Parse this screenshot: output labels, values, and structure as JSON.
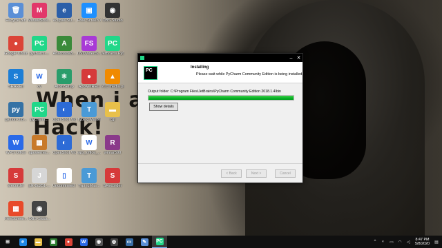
{
  "wallpaper": {
    "line1": "When i am",
    "line2": "Hack!"
  },
  "desktop_icons": [
    {
      "label": "Recycle Bin",
      "icon": "recycle-bin-icon",
      "color": "#5a8fd6",
      "glyph": "🗑"
    },
    {
      "label": "MovaviScre...",
      "icon": "movavi-icon",
      "color": "#e2386a",
      "glyph": "M"
    },
    {
      "label": "eclipse-SD...",
      "icon": "eclipse-shortcut-icon",
      "color": "#2c5fa8",
      "glyph": "e"
    },
    {
      "label": "Free Screen Video Re...",
      "icon": "free-screen-recorder-icon",
      "color": "#1e90ff",
      "glyph": "▣"
    },
    {
      "label": "OBS Studio",
      "icon": "obs-studio-icon",
      "color": "#333333",
      "glyph": "◉"
    },
    {
      "label": "Google Chrome",
      "icon": "chrome-icon",
      "color": "#db4437",
      "glyph": "●"
    },
    {
      "label": "pycharm-...",
      "icon": "pycharm-icon",
      "color": "#21d789",
      "glyph": "PC"
    },
    {
      "label": "Anaconda3...",
      "icon": "anaconda-icon",
      "color": "#3a8a3a",
      "glyph": "A"
    },
    {
      "label": "DVDVideoS... FreeStudio",
      "icon": "dvdvideosoft-icon",
      "color": "#a83ad6",
      "glyph": "FS"
    },
    {
      "label": "JetBrains PyCharm ...",
      "icon": "jetbrains-pycharm-icon",
      "color": "#21d789",
      "glyph": "PC"
    },
    {
      "label": "SHAREit",
      "icon": "shareit-icon",
      "color": "#1c7ed6",
      "glyph": "S"
    },
    {
      "label": "cv",
      "icon": "file-icon",
      "color": "#ffffff",
      "glyph": "W"
    },
    {
      "label": "AtomSetup",
      "icon": "atom-icon",
      "color": "#2a9d6b",
      "glyph": "⚛"
    },
    {
      "label": "ApowerREC",
      "icon": "apowerrec-icon",
      "color": "#d63a3a",
      "glyph": "●"
    },
    {
      "label": "VLC media player",
      "icon": "vlc-icon",
      "color": "#f08a00",
      "glyph": "▲"
    },
    {
      "label": "python-3.8...",
      "icon": "python-icon",
      "color": "#3572a5",
      "glyph": "py"
    },
    {
      "label": "pycharm...",
      "icon": "pycharm2-icon",
      "color": "#21d789",
      "glyph": "PC"
    },
    {
      "label": "OpenShot Video ...",
      "icon": "openshot-icon",
      "color": "#2d6bd6",
      "glyph": "◐"
    },
    {
      "label": "Typing Master 10",
      "icon": "typing-master-icon",
      "color": "#4a9ad6",
      "glyph": "T"
    },
    {
      "label": "cgl",
      "icon": "folder-icon",
      "color": "#e8c04a",
      "glyph": "▬"
    },
    {
      "label": "WPS Office",
      "icon": "wps-office-icon",
      "color": "#2a6ae8",
      "glyph": "W"
    },
    {
      "label": "apowerrec...",
      "icon": "apowerrec-installer-icon",
      "color": "#c87a2a",
      "glyph": "▦"
    },
    {
      "label": "OpenShot Video Editor",
      "icon": "openshot-editor-icon",
      "color": "#2d6bd6",
      "glyph": "◐"
    },
    {
      "label": "wps_office_...",
      "icon": "wps-installer-icon",
      "color": "#ffffff",
      "glyph": "W"
    },
    {
      "label": "winrar590",
      "icon": "winrar-icon",
      "color": "#8a3a8a",
      "glyph": "R"
    },
    {
      "label": "srecorder",
      "icon": "srecorder-icon",
      "color": "#d63a3a",
      "glyph": "S"
    },
    {
      "label": "jdk-8u251-...",
      "icon": "jdk-icon",
      "color": "#d6d6d6",
      "glyph": "J"
    },
    {
      "label": "Unconfirmed 172065.crd...",
      "icon": "unconfirmed-file-icon",
      "color": "#ffffff",
      "glyph": "▯"
    },
    {
      "label": "TypingMas...",
      "icon": "typingmaster-installer-icon",
      "color": "#4a9ad6",
      "glyph": "T"
    },
    {
      "label": "SRecorder",
      "icon": "srecorder2-icon",
      "color": "#d63a3a",
      "glyph": "S"
    },
    {
      "label": "FreeScreen...",
      "icon": "freescreen-installer-icon",
      "color": "#e84a2a",
      "glyph": "▦"
    },
    {
      "label": "OBS-Studi...",
      "icon": "obs-installer-icon",
      "color": "#444444",
      "glyph": "◉"
    }
  ],
  "installer": {
    "heading": "Installing",
    "subheading": "Please wait while PyCharm Community Edition is being installed.",
    "output_folder": "Output folder: C:\\Program Files\\JetBrains\\PyCharm Community Edition 2018.1.4\\bin",
    "progress": 1.0,
    "details_label": "Show details",
    "back_label": "< Back",
    "next_label": "Next >",
    "cancel_label": "Cancel",
    "logo_text": "PC",
    "accent": "#06b025"
  },
  "taskbar": {
    "items": [
      {
        "icon": "windows-start-icon",
        "glyph": "⊞",
        "color": "#ffffff"
      },
      {
        "icon": "internet-explorer-icon",
        "glyph": "e",
        "color": "#1e88e5"
      },
      {
        "icon": "file-explorer-icon",
        "glyph": "▬",
        "color": "#e8c04a"
      },
      {
        "icon": "xbox-icon",
        "glyph": "▣",
        "color": "#2e7d32"
      },
      {
        "icon": "chrome-taskbar-icon",
        "glyph": "●",
        "color": "#db4437"
      },
      {
        "icon": "wps-taskbar-icon",
        "glyph": "W",
        "color": "#2a6ae8"
      },
      {
        "icon": "obs-taskbar-icon",
        "glyph": "◉",
        "color": "#555555"
      },
      {
        "icon": "camera-icon",
        "glyph": "◍",
        "color": "#444444"
      },
      {
        "icon": "monitor-icon",
        "glyph": "▭",
        "color": "#3a6ea5"
      },
      {
        "icon": "notes-icon",
        "glyph": "✎",
        "color": "#5a8fd6"
      },
      {
        "icon": "pycharm-taskbar-icon",
        "glyph": "PC",
        "color": "#21d789"
      }
    ],
    "time": "8:47 PM",
    "date": "5/8/2020"
  }
}
